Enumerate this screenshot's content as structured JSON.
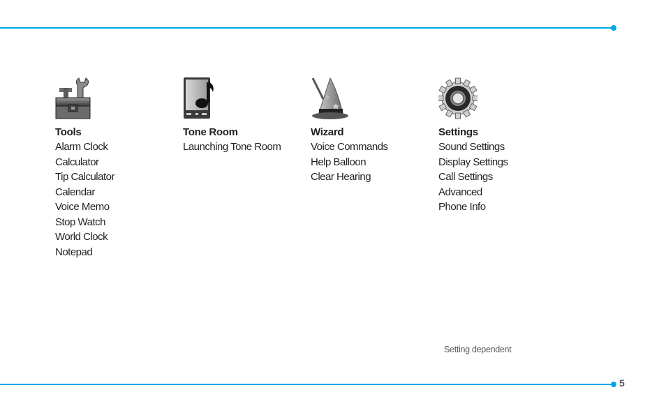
{
  "page_number": "5",
  "accent_color": "#00a8e6",
  "footnote": "Setting dependent",
  "columns": [
    {
      "icon": "toolbox-icon",
      "title": "Tools",
      "items": [
        "Alarm Clock",
        "Calculator",
        "Tip Calculator",
        "Calendar",
        "Voice Memo",
        "Stop Watch",
        "World Clock",
        "Notepad"
      ]
    },
    {
      "icon": "music-phone-icon",
      "title": "Tone Room",
      "items": [
        "Launching Tone Room"
      ]
    },
    {
      "icon": "wizard-hat-icon",
      "title": "Wizard",
      "items": [
        "Voice Commands",
        "Help Balloon",
        "Clear Hearing"
      ]
    },
    {
      "icon": "gear-icon",
      "title": "Settings",
      "items": [
        "Sound Settings",
        "Display Settings",
        "Call Settings",
        "Advanced",
        "Phone Info"
      ]
    }
  ]
}
